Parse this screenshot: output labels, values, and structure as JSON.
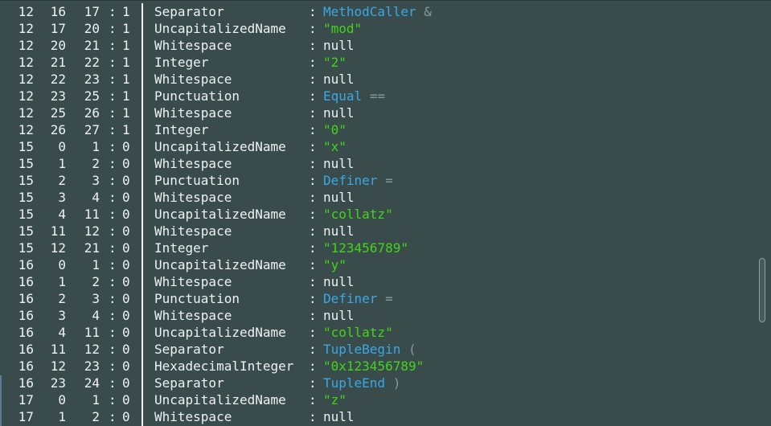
{
  "rows": [
    {
      "line": "12",
      "start": "16",
      "end": "17",
      "flag": "1",
      "type": "Separator",
      "sep": ":",
      "kind": "MethodCaller",
      "symbol": "&",
      "str": "",
      "null": ""
    },
    {
      "line": "12",
      "start": "17",
      "end": "20",
      "flag": "1",
      "type": "UncapitalizedName",
      "sep": ":",
      "kind": "",
      "symbol": "",
      "str": "\"mod\"",
      "null": ""
    },
    {
      "line": "12",
      "start": "20",
      "end": "21",
      "flag": "1",
      "type": "Whitespace",
      "sep": ":",
      "kind": "",
      "symbol": "",
      "str": "",
      "null": "null"
    },
    {
      "line": "12",
      "start": "21",
      "end": "22",
      "flag": "1",
      "type": "Integer",
      "sep": ":",
      "kind": "",
      "symbol": "",
      "str": "\"2\"",
      "null": ""
    },
    {
      "line": "12",
      "start": "22",
      "end": "23",
      "flag": "1",
      "type": "Whitespace",
      "sep": ":",
      "kind": "",
      "symbol": "",
      "str": "",
      "null": "null"
    },
    {
      "line": "12",
      "start": "23",
      "end": "25",
      "flag": "1",
      "type": "Punctuation",
      "sep": ":",
      "kind": "Equal",
      "symbol": "==",
      "str": "",
      "null": ""
    },
    {
      "line": "12",
      "start": "25",
      "end": "26",
      "flag": "1",
      "type": "Whitespace",
      "sep": ":",
      "kind": "",
      "symbol": "",
      "str": "",
      "null": "null"
    },
    {
      "line": "12",
      "start": "26",
      "end": "27",
      "flag": "1",
      "type": "Integer",
      "sep": ":",
      "kind": "",
      "symbol": "",
      "str": "\"0\"",
      "null": ""
    },
    {
      "line": "15",
      "start": "0",
      "end": "1",
      "flag": "0",
      "type": "UncapitalizedName",
      "sep": ":",
      "kind": "",
      "symbol": "",
      "str": "\"x\"",
      "null": ""
    },
    {
      "line": "15",
      "start": "1",
      "end": "2",
      "flag": "0",
      "type": "Whitespace",
      "sep": ":",
      "kind": "",
      "symbol": "",
      "str": "",
      "null": "null"
    },
    {
      "line": "15",
      "start": "2",
      "end": "3",
      "flag": "0",
      "type": "Punctuation",
      "sep": ":",
      "kind": "Definer",
      "symbol": "=",
      "str": "",
      "null": ""
    },
    {
      "line": "15",
      "start": "3",
      "end": "4",
      "flag": "0",
      "type": "Whitespace",
      "sep": ":",
      "kind": "",
      "symbol": "",
      "str": "",
      "null": "null"
    },
    {
      "line": "15",
      "start": "4",
      "end": "11",
      "flag": "0",
      "type": "UncapitalizedName",
      "sep": ":",
      "kind": "",
      "symbol": "",
      "str": "\"collatz\"",
      "null": ""
    },
    {
      "line": "15",
      "start": "11",
      "end": "12",
      "flag": "0",
      "type": "Whitespace",
      "sep": ":",
      "kind": "",
      "symbol": "",
      "str": "",
      "null": "null"
    },
    {
      "line": "15",
      "start": "12",
      "end": "21",
      "flag": "0",
      "type": "Integer",
      "sep": ":",
      "kind": "",
      "symbol": "",
      "str": "\"123456789\"",
      "null": ""
    },
    {
      "line": "16",
      "start": "0",
      "end": "1",
      "flag": "0",
      "type": "UncapitalizedName",
      "sep": ":",
      "kind": "",
      "symbol": "",
      "str": "\"y\"",
      "null": ""
    },
    {
      "line": "16",
      "start": "1",
      "end": "2",
      "flag": "0",
      "type": "Whitespace",
      "sep": ":",
      "kind": "",
      "symbol": "",
      "str": "",
      "null": "null"
    },
    {
      "line": "16",
      "start": "2",
      "end": "3",
      "flag": "0",
      "type": "Punctuation",
      "sep": ":",
      "kind": "Definer",
      "symbol": "=",
      "str": "",
      "null": ""
    },
    {
      "line": "16",
      "start": "3",
      "end": "4",
      "flag": "0",
      "type": "Whitespace",
      "sep": ":",
      "kind": "",
      "symbol": "",
      "str": "",
      "null": "null"
    },
    {
      "line": "16",
      "start": "4",
      "end": "11",
      "flag": "0",
      "type": "UncapitalizedName",
      "sep": ":",
      "kind": "",
      "symbol": "",
      "str": "\"collatz\"",
      "null": ""
    },
    {
      "line": "16",
      "start": "11",
      "end": "12",
      "flag": "0",
      "type": "Separator",
      "sep": ":",
      "kind": "TupleBegin",
      "symbol": "(",
      "str": "",
      "null": ""
    },
    {
      "line": "16",
      "start": "12",
      "end": "23",
      "flag": "0",
      "type": "HexadecimalInteger",
      "sep": ":",
      "kind": "",
      "symbol": "",
      "str": "\"0x123456789\"",
      "null": ""
    },
    {
      "line": "16",
      "start": "23",
      "end": "24",
      "flag": "0",
      "type": "Separator",
      "sep": ":",
      "kind": "TupleEnd",
      "symbol": ")",
      "str": "",
      "null": ""
    },
    {
      "line": "17",
      "start": "0",
      "end": "1",
      "flag": "0",
      "type": "UncapitalizedName",
      "sep": ":",
      "kind": "",
      "symbol": "",
      "str": "\"z\"",
      "null": ""
    },
    {
      "line": "17",
      "start": "1",
      "end": "2",
      "flag": "0",
      "type": "Whitespace",
      "sep": ":",
      "kind": "",
      "symbol": "",
      "str": "",
      "null": "null"
    }
  ],
  "colon": ":",
  "colors": {
    "background": "#394b4b",
    "text": "#eef2f2",
    "string": "#44d419",
    "kind": "#3aa8e6",
    "symbol": "#8a9a9a"
  }
}
